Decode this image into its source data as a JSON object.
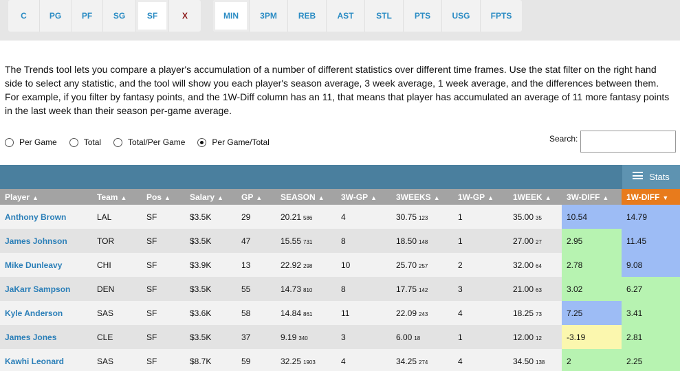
{
  "filters": {
    "positions": [
      {
        "label": "C",
        "active": false
      },
      {
        "label": "PG",
        "active": false
      },
      {
        "label": "PF",
        "active": false
      },
      {
        "label": "SG",
        "active": false
      },
      {
        "label": "SF",
        "active": true
      },
      {
        "label": "X",
        "active": false
      }
    ],
    "stats": [
      {
        "label": "MIN",
        "active": true
      },
      {
        "label": "3PM",
        "active": false
      },
      {
        "label": "REB",
        "active": false
      },
      {
        "label": "AST",
        "active": false
      },
      {
        "label": "STL",
        "active": false
      },
      {
        "label": "PTS",
        "active": false
      },
      {
        "label": "USG",
        "active": false
      },
      {
        "label": "FPTS",
        "active": false
      }
    ]
  },
  "description": "The Trends tool lets you compare a player's accumulation of a number of different statistics over different time frames. Use the stat filter on the right hand side to select any statistic, and the tool will show you each player's season average, 3 week average, 1 week average, and the differences between them. For example, if you filter by fantasy points, and the 1W-Diff column has an 11, that means that player has accumulated an average of 11 more fantasy points in the last week than their season per-game average.",
  "view_modes": [
    {
      "label": "Per Game",
      "checked": false
    },
    {
      "label": "Total",
      "checked": false
    },
    {
      "label": "Total/Per Game",
      "checked": false
    },
    {
      "label": "Per Game/Total",
      "checked": true
    }
  ],
  "search": {
    "label": "Search:",
    "value": ""
  },
  "stats_toggle_label": "Stats",
  "colors": {
    "header_bar": "#4a7f9e",
    "column_header": "#a3a3a3",
    "sorted_header": "#e87b1c",
    "link": "#2b7fb8",
    "diff_blue": "#9dbcf5",
    "diff_green": "#b7f3b1",
    "diff_yellow": "#fbf7ae"
  },
  "table": {
    "columns": [
      "Player",
      "Team",
      "Pos",
      "Salary",
      "GP",
      "SEASON",
      "3W-GP",
      "3WEEKS",
      "1W-GP",
      "1WEEK",
      "3W-DIFF",
      "1W-DIFF"
    ],
    "sorted_column": "1W-DIFF",
    "rows": [
      {
        "player": "Anthony Brown",
        "team": "LAL",
        "pos": "SF",
        "salary": "$3.5K",
        "gp": "29",
        "season": "20.21",
        "season_total": "586",
        "gp3w": "4",
        "weeks3": "30.75",
        "weeks3_total": "123",
        "gp1w": "1",
        "week1": "35.00",
        "week1_total": "35",
        "diff3w": "10.54",
        "diff3w_color": "blue",
        "diff1w": "14.79",
        "diff1w_color": "blue"
      },
      {
        "player": "James Johnson",
        "team": "TOR",
        "pos": "SF",
        "salary": "$3.5K",
        "gp": "47",
        "season": "15.55",
        "season_total": "731",
        "gp3w": "8",
        "weeks3": "18.50",
        "weeks3_total": "148",
        "gp1w": "1",
        "week1": "27.00",
        "week1_total": "27",
        "diff3w": "2.95",
        "diff3w_color": "green",
        "diff1w": "11.45",
        "diff1w_color": "blue"
      },
      {
        "player": "Mike Dunleavy",
        "team": "CHI",
        "pos": "SF",
        "salary": "$3.9K",
        "gp": "13",
        "season": "22.92",
        "season_total": "298",
        "gp3w": "10",
        "weeks3": "25.70",
        "weeks3_total": "257",
        "gp1w": "2",
        "week1": "32.00",
        "week1_total": "64",
        "diff3w": "2.78",
        "diff3w_color": "green",
        "diff1w": "9.08",
        "diff1w_color": "blue"
      },
      {
        "player": "JaKarr Sampson",
        "team": "DEN",
        "pos": "SF",
        "salary": "$3.5K",
        "gp": "55",
        "season": "14.73",
        "season_total": "810",
        "gp3w": "8",
        "weeks3": "17.75",
        "weeks3_total": "142",
        "gp1w": "3",
        "week1": "21.00",
        "week1_total": "63",
        "diff3w": "3.02",
        "diff3w_color": "green",
        "diff1w": "6.27",
        "diff1w_color": "green"
      },
      {
        "player": "Kyle Anderson",
        "team": "SAS",
        "pos": "SF",
        "salary": "$3.6K",
        "gp": "58",
        "season": "14.84",
        "season_total": "861",
        "gp3w": "11",
        "weeks3": "22.09",
        "weeks3_total": "243",
        "gp1w": "4",
        "week1": "18.25",
        "week1_total": "73",
        "diff3w": "7.25",
        "diff3w_color": "blue",
        "diff1w": "3.41",
        "diff1w_color": "green"
      },
      {
        "player": "James Jones",
        "team": "CLE",
        "pos": "SF",
        "salary": "$3.5K",
        "gp": "37",
        "season": "9.19",
        "season_total": "340",
        "gp3w": "3",
        "weeks3": "6.00",
        "weeks3_total": "18",
        "gp1w": "1",
        "week1": "12.00",
        "week1_total": "12",
        "diff3w": "-3.19",
        "diff3w_color": "yellow",
        "diff1w": "2.81",
        "diff1w_color": "green"
      },
      {
        "player": "Kawhi Leonard",
        "team": "SAS",
        "pos": "SF",
        "salary": "$8.7K",
        "gp": "59",
        "season": "32.25",
        "season_total": "1903",
        "gp3w": "4",
        "weeks3": "34.25",
        "weeks3_total": "274",
        "gp1w": "4",
        "week1": "34.50",
        "week1_total": "138",
        "diff3w": "2",
        "diff3w_color": "green",
        "diff1w": "2.25",
        "diff1w_color": "green"
      }
    ]
  }
}
